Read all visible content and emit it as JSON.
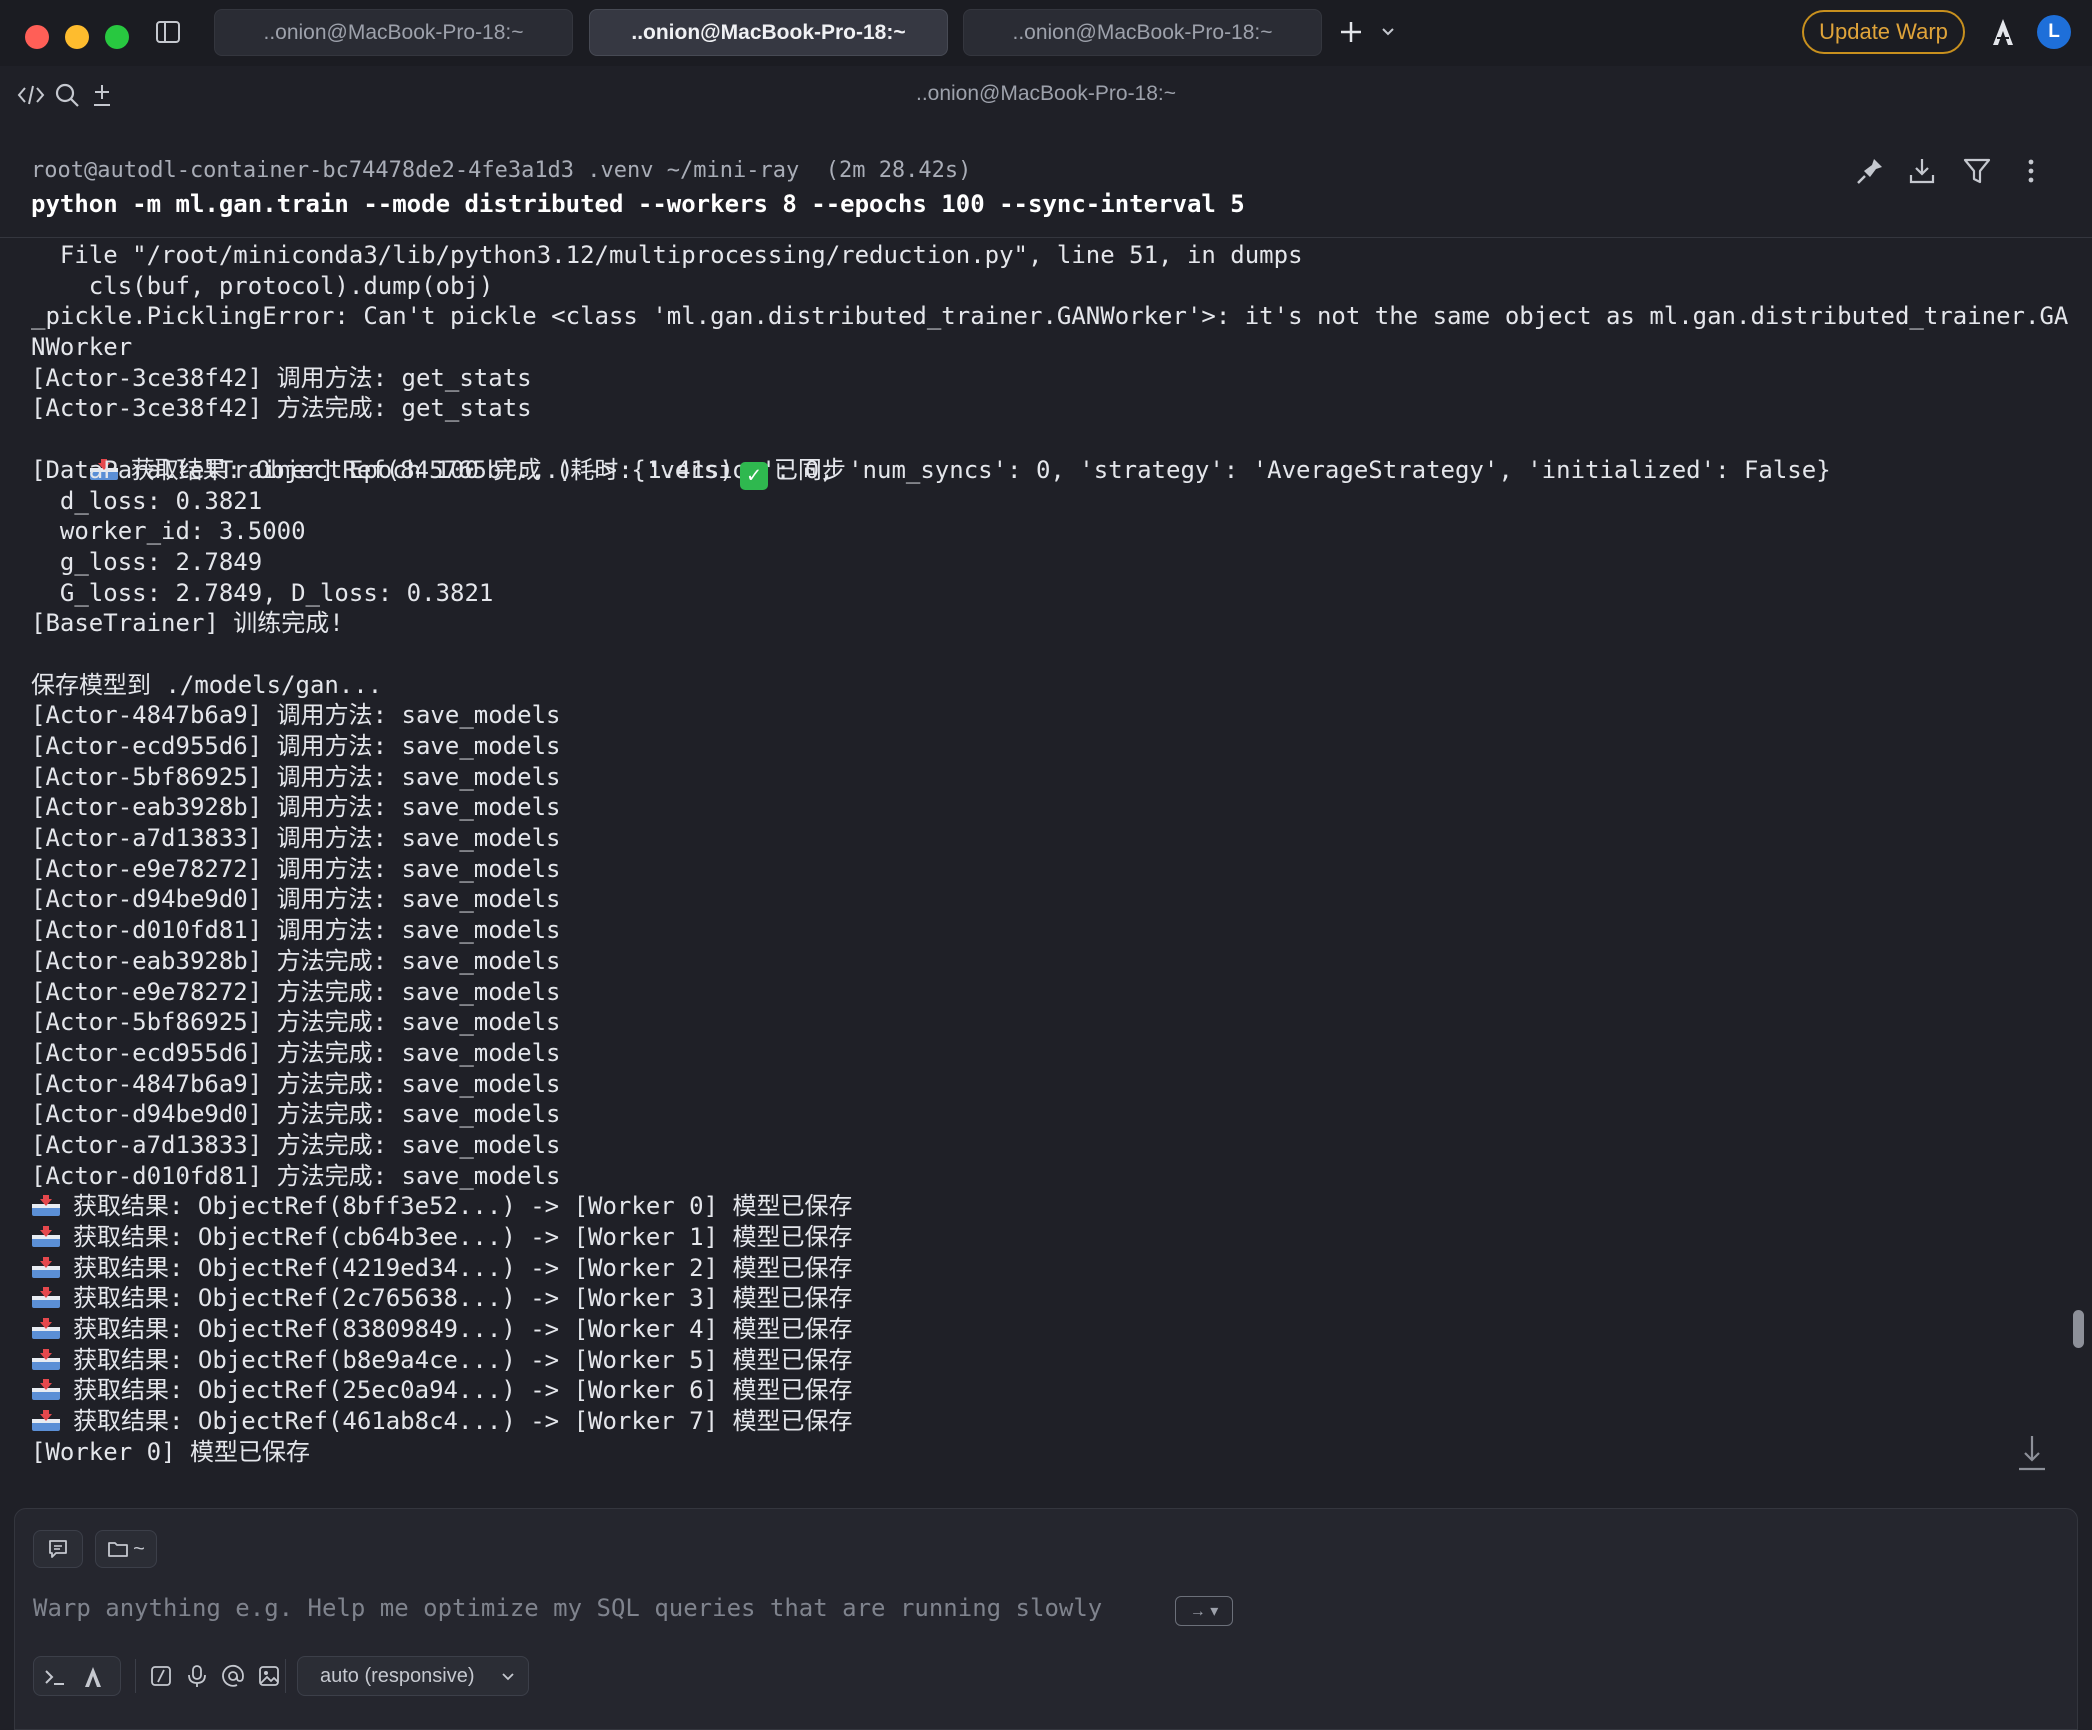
{
  "titlebar": {
    "tabs": [
      {
        "label": "..onion@MacBook-Pro-18:~"
      },
      {
        "label": "..onion@MacBook-Pro-18:~"
      },
      {
        "label": "..onion@MacBook-Pro-18:~"
      }
    ],
    "update_label": "Update Warp",
    "avatar_initial": "L"
  },
  "window_title": "..onion@MacBook-Pro-18:~",
  "block": {
    "prompt": "root@autodl-container-bc74478de2-4fe3a1d3 .venv ~/mini-ray  (2m 28.42s)",
    "command": "python -m ml.gan.train --mode distributed --workers 8 --epochs 100 --sync-interval 5"
  },
  "output": {
    "cut_top": "^^^^^^^^^^^^^^^^^^^^^^^^^^",
    "lines": [
      "  File \"/root/miniconda3/lib/python3.12/multiprocessing/reduction.py\", line 51, in dumps",
      "    cls(buf, protocol).dump(obj)",
      "_pickle.PicklingError: Can't pickle <class 'ml.gan.distributed_trainer.GANWorker'>: it's not the same object as ml.gan.distributed_trainer.GA",
      "NWorker",
      "[Actor-3ce38f42] 调用方法: get_stats",
      "[Actor-3ce38f42] 方法完成: get_stats"
    ],
    "stats_result": "获取结果: ObjectRef(845765bf...) -> {'version': 0, 'num_syncs': 0, 'strategy': 'AverageStrategy', 'initialized': False}",
    "epoch_prefix": "[DataParallelTrainer] Epoch 100 完成 (耗时: 1.41s)",
    "epoch_check": "✓",
    "epoch_suffix": "已同步",
    "lines2": [
      "  d_loss: 0.3821",
      "  worker_id: 3.5000",
      "  g_loss: 2.7849",
      "  G_loss: 2.7849, D_loss: 0.3821",
      "[BaseTrainer] 训练完成!",
      "",
      "保存模型到 ./models/gan...",
      "[Actor-4847b6a9] 调用方法: save_models",
      "[Actor-ecd955d6] 调用方法: save_models",
      "[Actor-5bf86925] 调用方法: save_models",
      "[Actor-eab3928b] 调用方法: save_models",
      "[Actor-a7d13833] 调用方法: save_models",
      "[Actor-e9e78272] 调用方法: save_models",
      "[Actor-d94be9d0] 调用方法: save_models",
      "[Actor-d010fd81] 调用方法: save_models",
      "[Actor-eab3928b] 方法完成: save_models",
      "[Actor-e9e78272] 方法完成: save_models",
      "[Actor-5bf86925] 方法完成: save_models",
      "[Actor-ecd955d6] 方法完成: save_models",
      "[Actor-4847b6a9] 方法完成: save_models",
      "[Actor-d94be9d0] 方法完成: save_models",
      "[Actor-a7d13833] 方法完成: save_models",
      "[Actor-d010fd81] 方法完成: save_models"
    ],
    "results": [
      "获取结果: ObjectRef(8bff3e52...) -> [Worker 0] 模型已保存",
      "获取结果: ObjectRef(cb64b3ee...) -> [Worker 1] 模型已保存",
      "获取结果: ObjectRef(4219ed34...) -> [Worker 2] 模型已保存",
      "获取结果: ObjectRef(2c765638...) -> [Worker 3] 模型已保存",
      "获取结果: ObjectRef(83809849...) -> [Worker 4] 模型已保存",
      "获取结果: ObjectRef(b8e9a4ce...) -> [Worker 5] 模型已保存",
      "获取结果: ObjectRef(25ec0a94...) -> [Worker 6] 模型已保存",
      "获取结果: ObjectRef(461ab8c4...) -> [Worker 7] 模型已保存"
    ],
    "last_line": "[Worker 0] 模型已保存"
  },
  "input": {
    "dir_chip": "~",
    "placeholder": "Warp anything e.g. Help me optimize my SQL queries that are running slowly",
    "kbd_hint": "→ ▾",
    "model": "auto (responsive)"
  },
  "colors": {
    "background": "#1f2027",
    "accent_update": "#e0a43a",
    "avatar": "#1e6fd9",
    "check": "#2fb84f"
  }
}
